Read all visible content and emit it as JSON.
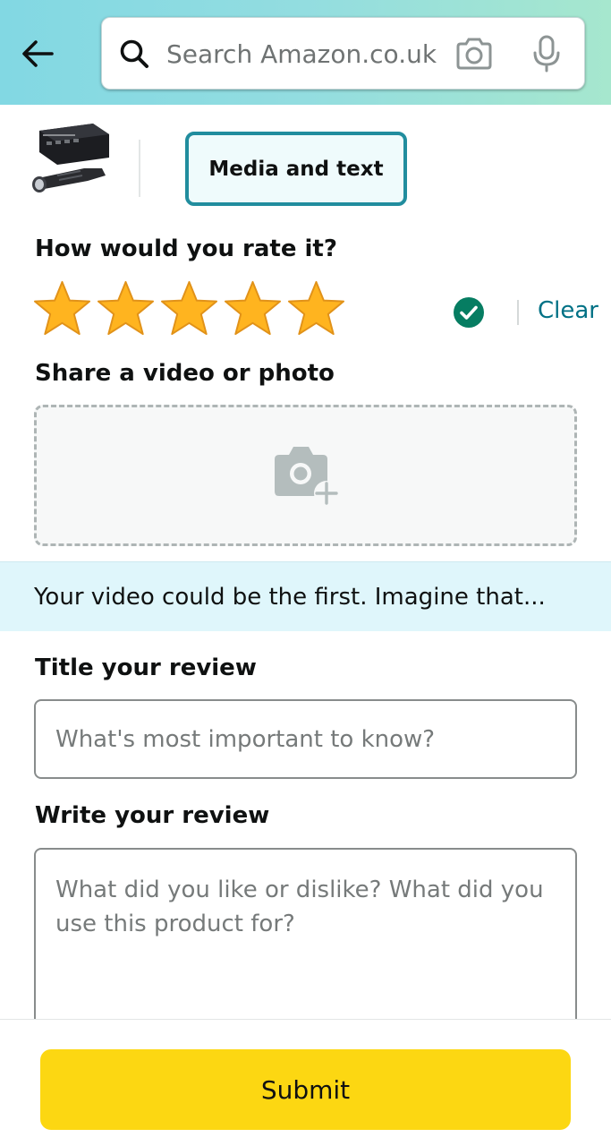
{
  "header": {
    "search_placeholder": "Search Amazon.co.uk",
    "icons": [
      "back-arrow-icon",
      "search-icon",
      "camera-icon",
      "microphone-icon"
    ]
  },
  "tabs": {
    "media_label": "Media and text"
  },
  "rating": {
    "title": "How would you rate it?",
    "stars": 5,
    "max_stars": 5,
    "star_color": "#ffa41c",
    "clear_label": "Clear",
    "check_color": "#067d62"
  },
  "media": {
    "title": "Share a video or photo",
    "banner_text": "Your video could be the first. Imagine that..."
  },
  "title_review": {
    "label": "Title your review",
    "placeholder": "What's most important to know?",
    "value": ""
  },
  "write_review": {
    "label": "Write your review",
    "placeholder": "What did you like or dislike? What did you use this product for?",
    "value": ""
  },
  "actions": {
    "submit_label": "Submit",
    "submit_color": "#fcd712"
  },
  "colors": {
    "accent_teal": "#218d9e",
    "link": "#007185",
    "info_band": "#dff6fb"
  }
}
